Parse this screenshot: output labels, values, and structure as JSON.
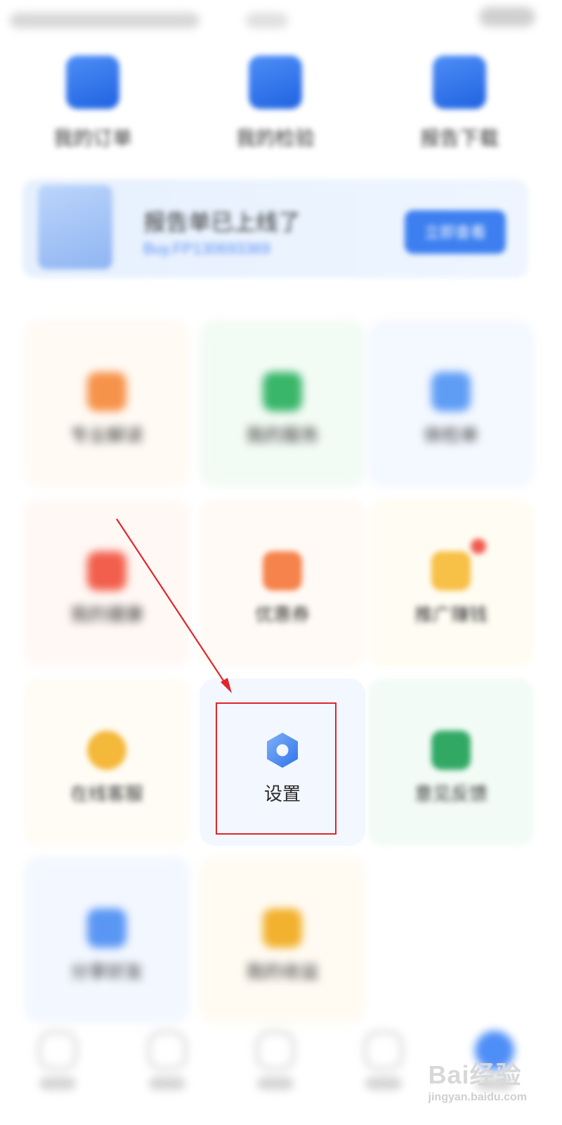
{
  "top_items": [
    {
      "label": "我的订单",
      "icon": "order-icon"
    },
    {
      "label": "我的检验",
      "icon": "report-icon"
    },
    {
      "label": "报告下载",
      "icon": "download-icon"
    }
  ],
  "banner": {
    "title": "报告单已上线了",
    "subtitle": "Buy.FP130693369",
    "button_label": "立即查看"
  },
  "grid": [
    {
      "label": "专业解读",
      "icon": "expert-icon",
      "tile_color": "#fffaf4",
      "icon_color": "#f6934a"
    },
    {
      "label": "我的服务",
      "icon": "service-icon",
      "tile_color": "#f3fbf5",
      "icon_color": "#39b66a"
    },
    {
      "label": "体检单",
      "icon": "checkup-icon",
      "tile_color": "#f4f8ff",
      "icon_color": "#5f9df5"
    },
    {
      "label": "我的健康",
      "icon": "health-icon",
      "tile_color": "#fff8f5",
      "icon_color": "#f25f4c"
    },
    {
      "label": "优惠券",
      "icon": "coupon-icon",
      "tile_color": "#fffaf5",
      "icon_color": "#f5834b"
    },
    {
      "label": "推广赚钱",
      "icon": "promo-icon",
      "tile_color": "#fffcf3",
      "icon_color": "#f7c046"
    },
    {
      "label": "在线客服",
      "icon": "headset-icon",
      "tile_color": "#fffcf5",
      "icon_color": "#f4b83a"
    },
    {
      "label": "设置",
      "icon": "settings-icon",
      "tile_color": "#f3f7ff",
      "icon_color": "#3f86f2"
    },
    {
      "label": "意见反馈",
      "icon": "feedback-icon",
      "tile_color": "#f3fbf6",
      "icon_color": "#31a965"
    },
    {
      "label": "分享好友",
      "icon": "share-icon",
      "tile_color": "#f3f7ff",
      "icon_color": "#5a97f4"
    },
    {
      "label": "我的收益",
      "icon": "wallet-icon",
      "tile_color": "#fffbf3",
      "icon_color": "#f2b12e"
    }
  ],
  "bottom_nav": [
    {
      "icon": "home-icon"
    },
    {
      "icon": "shield-icon"
    },
    {
      "icon": "grid-icon"
    },
    {
      "icon": "message-icon"
    },
    {
      "icon": "profile-icon",
      "active": true
    }
  ],
  "watermark": {
    "main": "Bai经验",
    "sub": "jingyan.baidu.com"
  },
  "colors": {
    "accent": "#3d7ff0",
    "highlight": "#e0262b"
  }
}
